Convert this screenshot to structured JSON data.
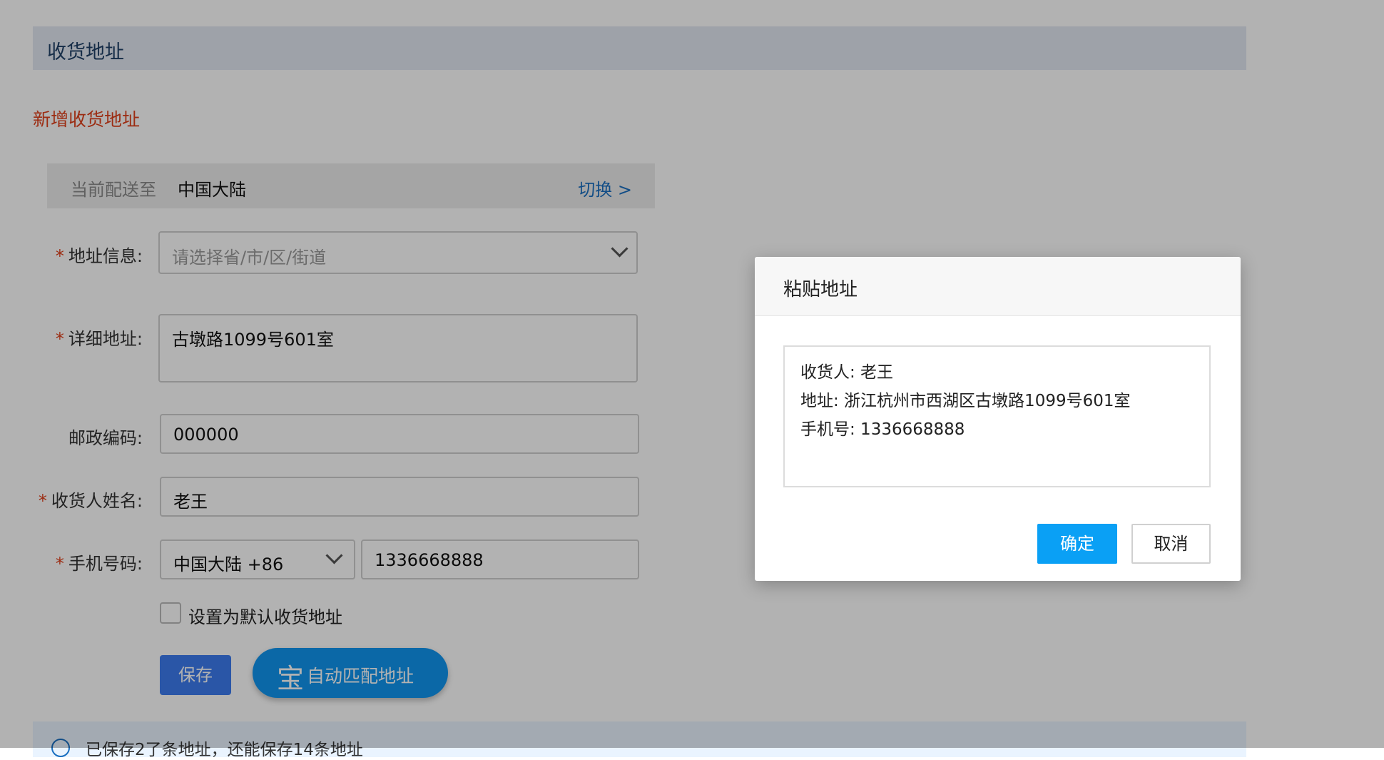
{
  "header": {
    "title": "收货地址"
  },
  "new_address_link": "新增收货地址",
  "shipping": {
    "label": "当前配送至",
    "value": "中国大陆",
    "switch": "切换 >"
  },
  "form": {
    "region": {
      "label": "地址信息:",
      "placeholder": "请选择省/市/区/街道"
    },
    "detail": {
      "label": "详细地址:",
      "value": "古墩路1099号601室"
    },
    "postcode": {
      "label": "邮政编码:",
      "value": "000000"
    },
    "name": {
      "label": "收货人姓名:",
      "value": "老王"
    },
    "phone": {
      "label": "手机号码:",
      "country": "中国大陆 +86",
      "value": "1336668888"
    },
    "default_label": "设置为默认收货地址",
    "save": "保存",
    "auto_match_icon": "宝",
    "auto_match": "自动匹配地址",
    "required_mark": "*"
  },
  "bottom_info": "已保存2了条地址，还能保存14条地址",
  "modal": {
    "title": "粘贴地址",
    "lines": [
      "收货人: 老王",
      "地址: 浙江杭州市西湖区古墩路1099号601室",
      "手机号: 1336668888"
    ],
    "ok": "确定",
    "cancel": "取消"
  }
}
